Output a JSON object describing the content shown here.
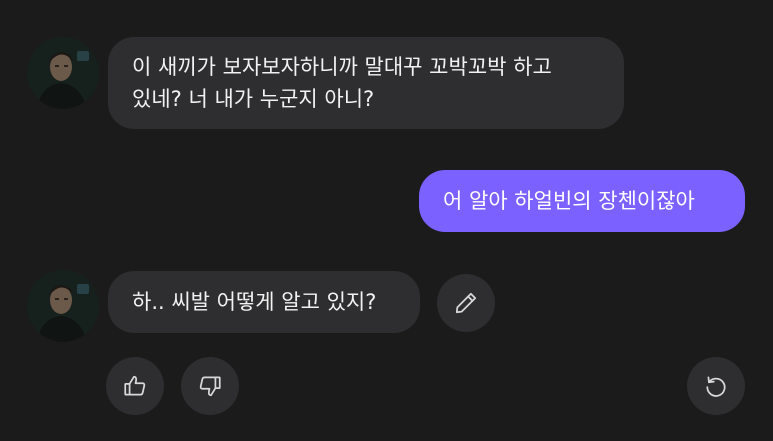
{
  "messages": [
    {
      "role": "character",
      "lines": [
        "이 새끼가 보자보자하니까 말대꾸 꼬박꼬박 하고",
        "있네? 너 내가 누군지 아니?"
      ]
    },
    {
      "role": "user",
      "text": "어 알아 하얼빈의 장첸이잖아"
    },
    {
      "role": "character",
      "text": "하.. 씨발 어떻게 알고 있지?"
    }
  ],
  "icons": {
    "edit": "pencil-icon",
    "like": "thumbs-up-icon",
    "dislike": "thumbs-down-icon",
    "regenerate": "refresh-icon"
  },
  "colors": {
    "background": "#1b1b1c",
    "bubble": "#2e2e30",
    "user_bubble": "#7b61ff",
    "icon": "#d8d8d8"
  }
}
